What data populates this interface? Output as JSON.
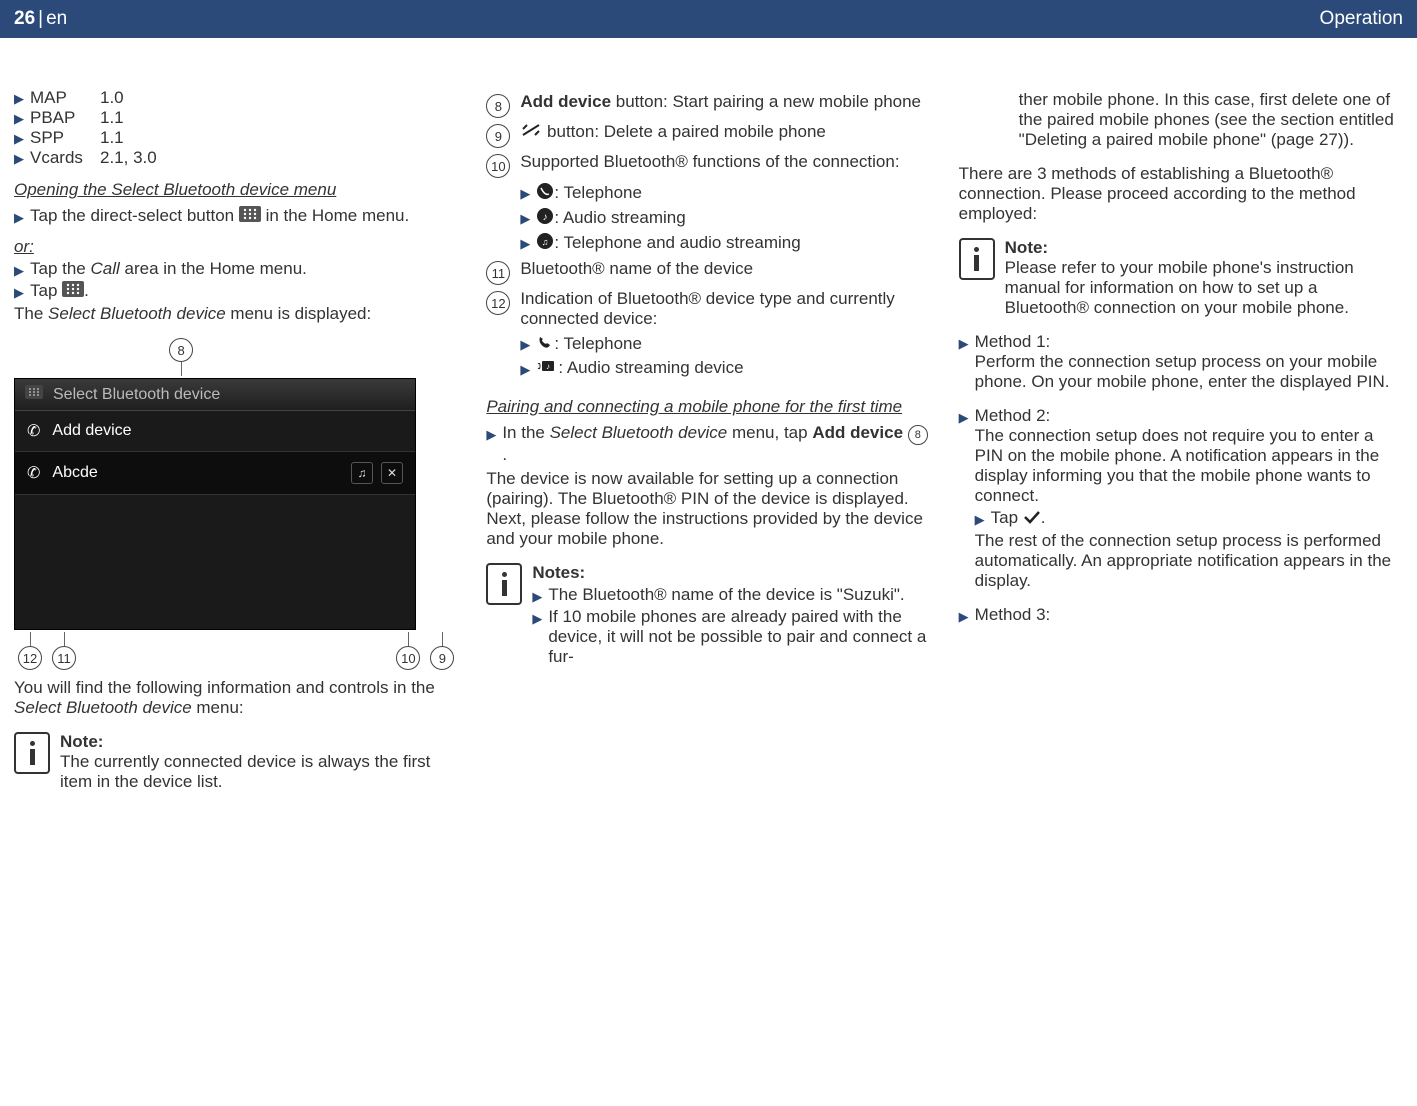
{
  "header": {
    "page": "26",
    "lang": "en",
    "section": "Operation"
  },
  "col1": {
    "specs": [
      {
        "name": "MAP",
        "ver": "1.0"
      },
      {
        "name": "PBAP",
        "ver": "1.1"
      },
      {
        "name": "SPP",
        "ver": "1.1"
      },
      {
        "name": "Vcards",
        "ver": "2.1, 3.0"
      }
    ],
    "head_open": "Opening the Select Bluetooth device menu",
    "tap_direct_a": "Tap the direct-select button ",
    "tap_direct_b": " in the Home menu.",
    "or": "or:",
    "tap_call_a": "Tap the ",
    "tap_call_it": "Call",
    "tap_call_b": " area in the Home menu.",
    "tap_icon": "Tap ",
    "period": ".",
    "menu_disp_a": "The ",
    "menu_disp_it": "Select Bluetooth device",
    "menu_disp_b": " menu is displayed:",
    "callout8": "8",
    "shot_title": "Select Bluetooth device",
    "shot_add": "Add device",
    "shot_dev": "Abcde",
    "callout9": "9",
    "callout10": "10",
    "callout11": "11",
    "callout12": "12",
    "after_a": "You will find the following information and controls in the ",
    "after_it": "Select Bluetooth device",
    "after_b": " menu:",
    "note_title": "Note:",
    "note_body": "The currently connected device is always the first item in the device list."
  },
  "col2": {
    "n8": "8",
    "t8a": "Add device",
    "t8b": " button: Start pairing a new mobile phone",
    "n9": "9",
    "t9": " button: Delete a paired mobile phone",
    "n10": "10",
    "t10": "Supported Bluetooth® functions of the connection:",
    "f_tel": ": Telephone",
    "f_aud": ": Audio streaming",
    "f_both": ": Telephone and audio streaming",
    "n11": "11",
    "t11": "Bluetooth® name of the device",
    "n12": "12",
    "t12": "Indication of Bluetooth® device type and currently connected device:",
    "d_tel": ": Telephone",
    "d_aud": ": Audio streaming device",
    "head_pair": "Pairing and connecting a mobile phone for the first time",
    "pair_a": "In the ",
    "pair_it": "Select Bluetooth device",
    "pair_b": " menu, tap ",
    "pair_bold": "Add device",
    "pair_c": " ",
    "pair_co": "8",
    "pair_d": ".",
    "avail": "The device is now available for setting up a connection (pairing). The Bluetooth® PIN of the device is displayed. Next, please follow the instructions provided by the device and your mobile phone.",
    "notes_title": "Notes:",
    "note1": "The Bluetooth® name of the device is \"Suzuki\".",
    "note2": "If 10 mobile phones are already paired with the device, it will not be possible to pair and connect a fur-"
  },
  "col3": {
    "cont": "ther mobile phone. In this case, first delete one of the paired mobile phones (see the section entitled \"Deleting a paired mobile phone\" (page 27)).",
    "methods_intro": "There are 3 methods of establishing a Bluetooth® connection. Please proceed according to the method employed:",
    "note_title": "Note:",
    "note_body": "Please refer to your mobile phone's instruction manual for information on how to set up a Bluetooth® connection on your mobile phone.",
    "m1_head": "Method 1:",
    "m1_body": "Perform the connection setup process on your mobile phone. On your mobile phone, enter the displayed PIN.",
    "m2_head": "Method 2:",
    "m2_body": "The connection setup does not require you to enter a PIN on the mobile phone. A notification appears in the display informing you that the mobile phone wants to connect.",
    "m2_tap": "Tap ",
    "m2_rest": "The rest of the connection setup process is performed automatically. An appropriate notification appears in the display.",
    "m3_head": "Method 3:"
  }
}
